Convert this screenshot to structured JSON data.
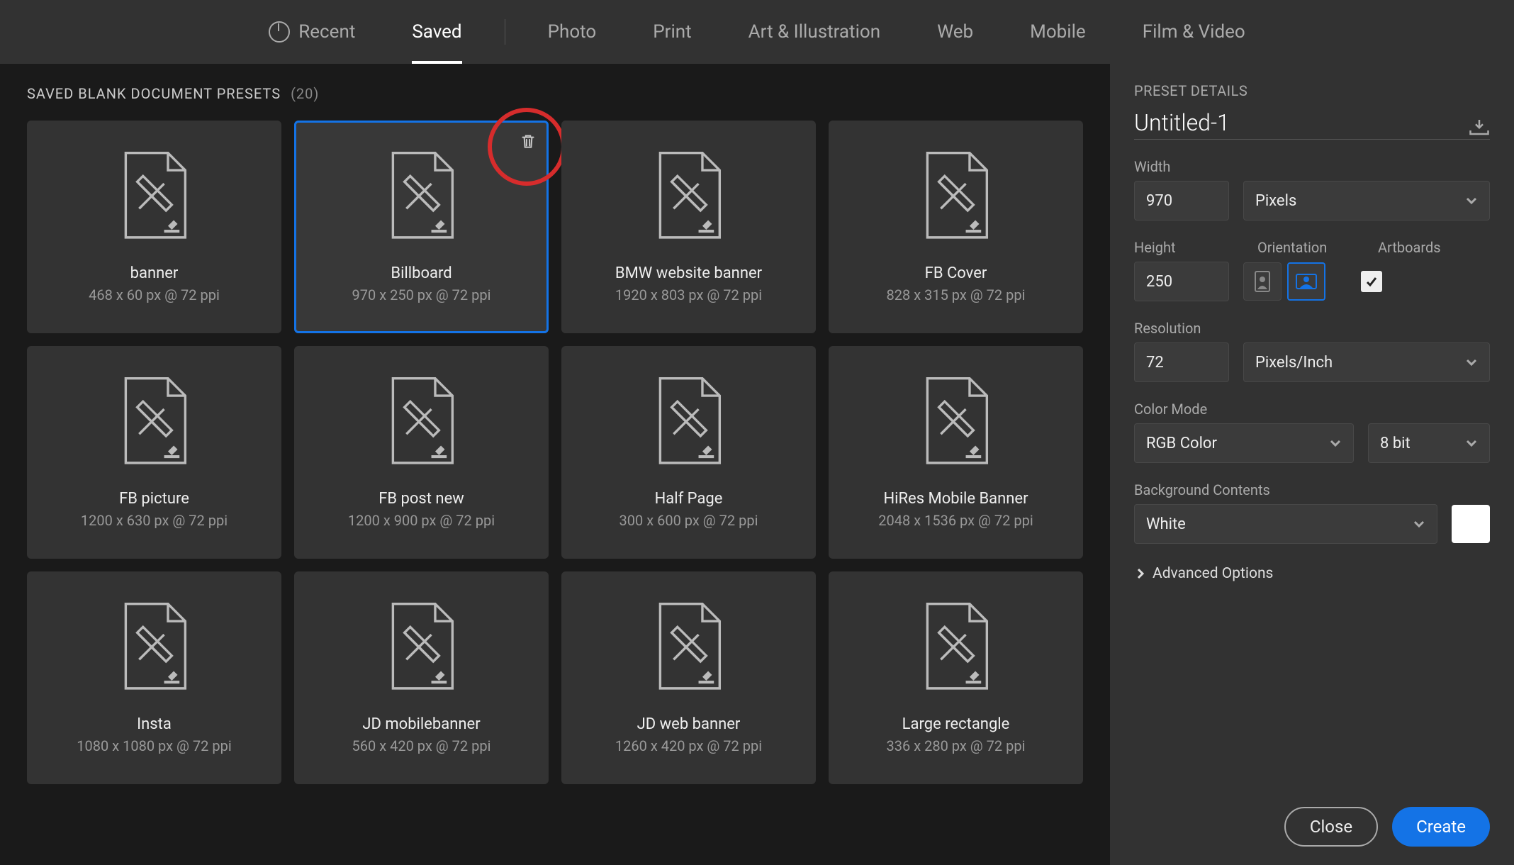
{
  "tabs": {
    "recent": "Recent",
    "saved": "Saved",
    "photo": "Photo",
    "print": "Print",
    "art": "Art & Illustration",
    "web": "Web",
    "mobile": "Mobile",
    "film": "Film & Video"
  },
  "section": {
    "title": "SAVED BLANK DOCUMENT PRESETS",
    "count": "(20)"
  },
  "presets": [
    {
      "name": "banner",
      "sub": "468 x 60 px @ 72 ppi"
    },
    {
      "name": "Billboard",
      "sub": "970 x 250 px @ 72 ppi",
      "selected": true,
      "trash": true
    },
    {
      "name": "BMW website banner",
      "sub": "1920 x 803 px @ 72 ppi"
    },
    {
      "name": "FB Cover",
      "sub": "828 x 315 px @ 72 ppi"
    },
    {
      "name": "FB picture",
      "sub": "1200 x 630 px @ 72 ppi"
    },
    {
      "name": "FB post new",
      "sub": "1200 x 900 px @ 72 ppi"
    },
    {
      "name": "Half Page",
      "sub": "300 x 600 px @ 72 ppi"
    },
    {
      "name": "HiRes Mobile Banner",
      "sub": "2048 x 1536 px @ 72 ppi"
    },
    {
      "name": "Insta",
      "sub": "1080 x 1080 px @ 72 ppi"
    },
    {
      "name": "JD mobilebanner",
      "sub": "560 x 420 px @ 72 ppi"
    },
    {
      "name": "JD web banner",
      "sub": "1260 x 420 px @ 72 ppi"
    },
    {
      "name": "Large rectangle",
      "sub": "336 x 280 px @ 72 ppi"
    }
  ],
  "details": {
    "header": "PRESET DETAILS",
    "name": "Untitled-1",
    "labels": {
      "width": "Width",
      "height": "Height",
      "orientation": "Orientation",
      "artboards": "Artboards",
      "resolution": "Resolution",
      "color_mode": "Color Mode",
      "bg": "Background Contents",
      "advanced": "Advanced Options"
    },
    "width": "970",
    "units": "Pixels",
    "height": "250",
    "artboards_checked": true,
    "resolution": "72",
    "resolution_units": "Pixels/Inch",
    "color_mode": "RGB Color",
    "bit_depth": "8 bit",
    "background": "White",
    "background_color": "#ffffff"
  },
  "buttons": {
    "close": "Close",
    "create": "Create"
  }
}
